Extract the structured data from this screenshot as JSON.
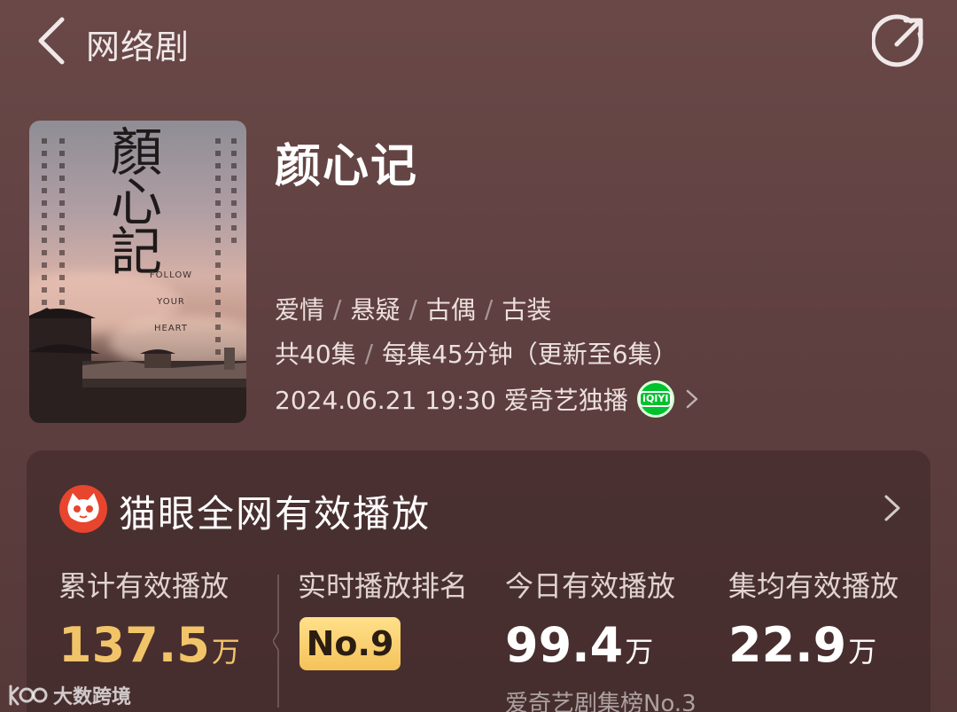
{
  "header": {
    "title": "网络剧",
    "back_icon": "chevron-left-icon",
    "share_icon": "share-icon"
  },
  "poster": {
    "title_calligraphy": "顏心記",
    "subtitle": "FOLLOW YOUR HEART"
  },
  "show": {
    "title": "颜心记",
    "genres": [
      "爱情",
      "悬疑",
      "古偶",
      "古装"
    ],
    "episodes_total": "共40集",
    "episode_length": "每集45分钟（更新至6集）",
    "airdate": "2024.06.21 19:30 爱奇艺独播",
    "platform_logo_text": "iQIYI",
    "platform_color": "#00c12e"
  },
  "card": {
    "title": "猫眼全网有效播放",
    "stats": [
      {
        "label": "累计有效播放",
        "value": "137.5",
        "unit": "万",
        "color": "#f2c469"
      },
      {
        "label": "实时播放排名",
        "value": "No.9"
      },
      {
        "label": "今日有效播放",
        "value": "99.4",
        "unit": "万",
        "sub": "爱奇艺剧集榜No.3"
      },
      {
        "label": "集均有效播放",
        "value": "22.9",
        "unit": "万"
      }
    ]
  },
  "watermark": {
    "text": "大数跨境"
  },
  "colors": {
    "background": "#5f4040",
    "accent_gold": "#f2c469",
    "badge_gold": "#f5c25a"
  }
}
